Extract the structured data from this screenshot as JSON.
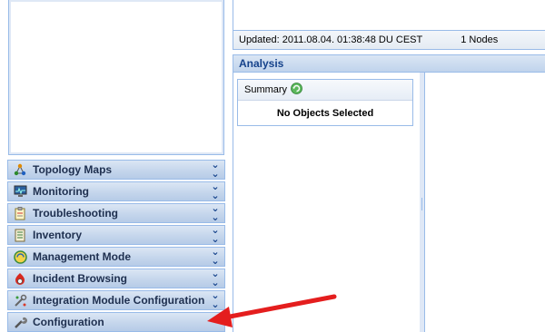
{
  "status": {
    "updated": "Updated: 2011.08.04. 01:38:48 DU CEST",
    "nodes": "1 Nodes"
  },
  "analysis": {
    "title": "Analysis",
    "summary_title": "Summary",
    "summary_empty": "No Objects Selected"
  },
  "workspaces": [
    {
      "label": "Topology Maps",
      "icon": "topology-icon"
    },
    {
      "label": "Monitoring",
      "icon": "monitor-icon"
    },
    {
      "label": "Troubleshooting",
      "icon": "troubleshooting-icon"
    },
    {
      "label": "Inventory",
      "icon": "inventory-icon"
    },
    {
      "label": "Management Mode",
      "icon": "management-mode-icon"
    },
    {
      "label": "Incident Browsing",
      "icon": "incident-icon"
    },
    {
      "label": "Integration Module Configuration",
      "icon": "integration-icon"
    },
    {
      "label": "Configuration",
      "icon": "wrench-icon"
    }
  ],
  "colors": {
    "panel_border": "#99bbe8",
    "header_text": "#15428b",
    "arrow": "#e41e1e"
  }
}
